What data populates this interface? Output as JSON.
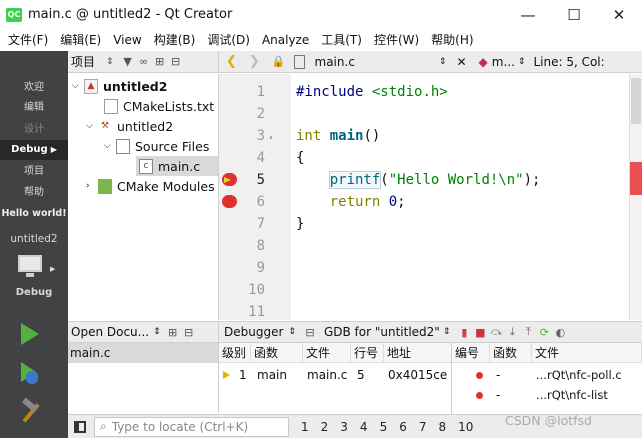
{
  "window": {
    "title": "main.c @ untitled2 - Qt Creator",
    "app_icon": "QC",
    "minimize": "—",
    "maximize": "☐",
    "close": "✕"
  },
  "menu": [
    "文件(F)",
    "编辑(E)",
    "View",
    "构建(B)",
    "调试(D)",
    "Analyze",
    "工具(T)",
    "控件(W)",
    "帮助(H)"
  ],
  "modes": {
    "welcome": "欢迎",
    "edit": "编辑",
    "design": "设计",
    "debug": "Debug",
    "projects": "项目",
    "help": "帮助",
    "hello": "Hello world!"
  },
  "kit": {
    "project": "untitled2",
    "config": "Debug"
  },
  "project_pane": {
    "title": "项目"
  },
  "tree": {
    "root": "untitled2",
    "cmakelists": "CMakeLists.txt",
    "project": "untitled2",
    "source_files": "Source Files",
    "main_c": "main.c",
    "cmake_modules": "CMake Modules"
  },
  "editor": {
    "file": "main.c",
    "symbol": "m...",
    "position": "Line: 5, Col:"
  },
  "line_numbers": [
    "1",
    "2",
    "3",
    "4",
    "5",
    "6",
    "7",
    "8",
    "9",
    "10",
    "11"
  ],
  "code": {
    "include_kw": "#include",
    "include_file": "<stdio.h>",
    "int_kw": "int",
    "main_fn": "main",
    "parens": "()",
    "lbrace": "{",
    "printf": "printf",
    "lparen": "(",
    "str": "\"Hello World!\\n\"",
    "rparen_semi": ");",
    "return_kw": "return",
    "zero": "0",
    "semi": ";",
    "rbrace": "}"
  },
  "open_docs": {
    "title": "Open Docu...",
    "items": [
      "main.c"
    ]
  },
  "debugger": {
    "title": "Debugger",
    "gdb": "GDB for \"untitled2\"",
    "headers": [
      "级别",
      "函数",
      "文件",
      "行号",
      "地址"
    ],
    "rows": [
      {
        "level": "1",
        "func": "main",
        "file": "main.c",
        "line": "5",
        "addr": "0x4015ce"
      }
    ]
  },
  "breakpoints": {
    "headers": [
      "编号",
      "函数",
      "文件"
    ],
    "rows": [
      {
        "func": "-",
        "file": "...rQt\\nfc-poll.c"
      },
      {
        "func": "-",
        "file": "...rQt\\nfc-list"
      }
    ]
  },
  "status": {
    "locate_placeholder": "Type to locate (Ctrl+K)",
    "tabs": [
      "1",
      "2",
      "3",
      "4",
      "5",
      "6",
      "7",
      "8",
      "10"
    ],
    "watermark": "CSDN @lotfsd"
  }
}
